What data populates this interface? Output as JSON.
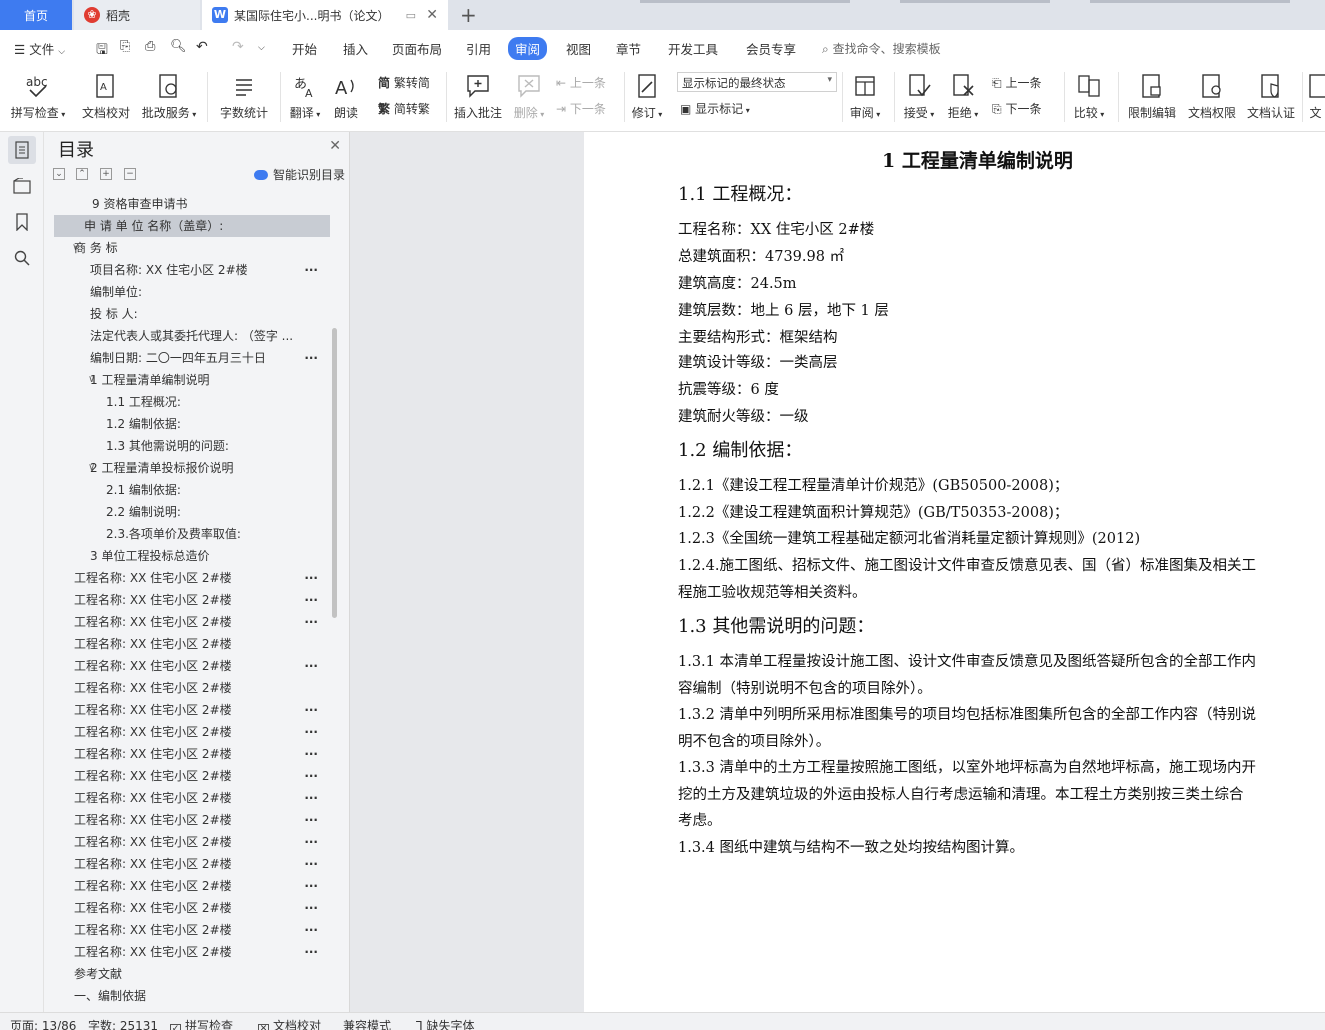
{
  "tabs": {
    "home": "首页",
    "daoke": "稻壳",
    "doc": "某国际住宅小...明书（论文）"
  },
  "menu": {
    "file": "文件",
    "items": [
      "开始",
      "插入",
      "页面布局",
      "引用",
      "审阅",
      "视图",
      "章节",
      "开发工具",
      "会员专享"
    ],
    "search": "查找命令、搜索模板"
  },
  "ribbon": {
    "spell_check": "拼写检查",
    "doc_check": "文档校对",
    "approval": "批改服务",
    "word_count": "字数统计",
    "translate": "翻译",
    "read_aloud": "朗读",
    "trad_to_simp": "繁转简",
    "simp_to_trad": "简转繁",
    "insert_comment": "插入批注",
    "delete": "删除",
    "prev_comment": "上一条",
    "next_comment": "下一条",
    "track": "修订",
    "markup_state": "显示标记的最终状态",
    "show_markup": "显示标记",
    "review_pane": "审阅",
    "accept": "接受",
    "reject": "拒绝",
    "prev_change": "上一条",
    "next_change": "下一条",
    "compare": "比较",
    "restrict": "限制编辑",
    "permission": "文档权限",
    "certify": "文档认证",
    "more": "文"
  },
  "toc": {
    "title": "目录",
    "smart": "智能识别目录",
    "items": [
      {
        "text": "9  资格审查申请书"
      },
      {
        "text": "申 请 单 位 名称（盖章）:",
        "selected": true
      },
      {
        "text": "商      务      标"
      },
      {
        "text": "项目名称:      XX 住宅小区 2#楼"
      },
      {
        "text": "编制单位:"
      },
      {
        "text": "投  标  人:"
      },
      {
        "text": "法定代表人或其委托代理人:          （签字 ..."
      },
      {
        "text": "编制日期:      二〇一四年五月三十日"
      },
      {
        "text": "1  工程量清单编制说明"
      },
      {
        "text": "1.1 工程概况:"
      },
      {
        "text": "1.2 编制依据:"
      },
      {
        "text": "1.3 其他需说明的问题:"
      },
      {
        "text": "2  工程量清单投标报价说明"
      },
      {
        "text": "2.1 编制依据:"
      },
      {
        "text": "2.2 编制说明:"
      },
      {
        "text": "2.3.各项单价及费率取值:"
      },
      {
        "text": "3  单位工程投标总造价"
      },
      {
        "text": "工程名称: XX 住宅小区 2#楼"
      },
      {
        "text": "工程名称: XX 住宅小区 2#楼"
      },
      {
        "text": "工程名称: XX 住宅小区 2#楼"
      },
      {
        "text": "工程名称: XX 住宅小区 2#楼"
      },
      {
        "text": "工程名称: XX 住宅小区 2#楼"
      },
      {
        "text": "工程名称: XX 住宅小区 2#楼"
      },
      {
        "text": "工程名称: XX 住宅小区 2#楼"
      },
      {
        "text": "工程名称: XX 住宅小区 2#楼"
      },
      {
        "text": "工程名称: XX 住宅小区 2#楼"
      },
      {
        "text": "工程名称: XX 住宅小区 2#楼"
      },
      {
        "text": "工程名称: XX 住宅小区 2#楼"
      },
      {
        "text": "工程名称: XX 住宅小区 2#楼"
      },
      {
        "text": "工程名称: XX 住宅小区 2#楼"
      },
      {
        "text": "工程名称: XX 住宅小区 2#楼"
      },
      {
        "text": "工程名称: XX 住宅小区 2#楼"
      },
      {
        "text": "工程名称: XX 住宅小区 2#楼"
      },
      {
        "text": "工程名称: XX 住宅小区 2#楼"
      },
      {
        "text": "工程名称: XX 住宅小区 2#楼"
      },
      {
        "text": "参考文献"
      },
      {
        "text": "一、编制依据"
      }
    ]
  },
  "doc": {
    "h1": "1  工程量清单编制说明",
    "s11": "1.1 工程概况：",
    "p_name": "工程名称：XX 住宅小区 2#楼",
    "p_area": "总建筑面积：4739.98 ㎡",
    "p_height": "建筑高度：24.5m",
    "p_floors": "建筑层数：地上 6 层，地下 1 层",
    "p_struct": "主要结构形式：框架结构",
    "p_grade": "建筑设计等级：一类高层",
    "p_seismic": "抗震等级：6 度",
    "p_fire": "建筑耐火等级：一级",
    "s12": "1.2 编制依据：",
    "p121": "1.2.1《建设工程工程量清单计价规范》(GB50500-2008)；",
    "p122": "1.2.2《建设工程建筑面积计算规范》(GB/T50353-2008)；",
    "p123": "1.2.3《全国统一建筑工程基础定额河北省消耗量定额计算规则》(2012)",
    "p124a": "1.2.4.施工图纸、招标文件、施工图设计文件审查反馈意见表、国（省）标准图集及相关工",
    "p124b": "程施工验收规范等相关资料。",
    "s13": "1.3 其他需说明的问题：",
    "p131a": "1.3.1 本清单工程量按设计施工图、设计文件审查反馈意见及图纸答疑所包含的全部工作内",
    "p131b": "容编制（特别说明不包含的项目除外）。",
    "p132a": "1.3.2 清单中列明所采用标准图集号的项目均包括标准图集所包含的全部工作内容（特别说",
    "p132b": "明不包含的项目除外）。",
    "p133a": "1.3.3 清单中的土方工程量按照施工图纸，以室外地坪标高为自然地坪标高，施工现场内开",
    "p133b": "挖的土方及建筑垃圾的外运由投标人自行考虑运输和清理。本工程土方类别按三类土综合",
    "p133c": "考虑。",
    "p134": "1.3.4 图纸中建筑与结构不一致之处均按结构图计算。"
  },
  "status": {
    "page": "页面: 13/86",
    "words": "字数: 25131",
    "spell": "拼写检查",
    "proof": "文档校对",
    "compat": "兼容模式",
    "missing_font": "缺失字体"
  },
  "colors": {
    "accent": "#3e7bf0",
    "panel": "#f3f4f6",
    "canvas": "#e7e8eb"
  }
}
